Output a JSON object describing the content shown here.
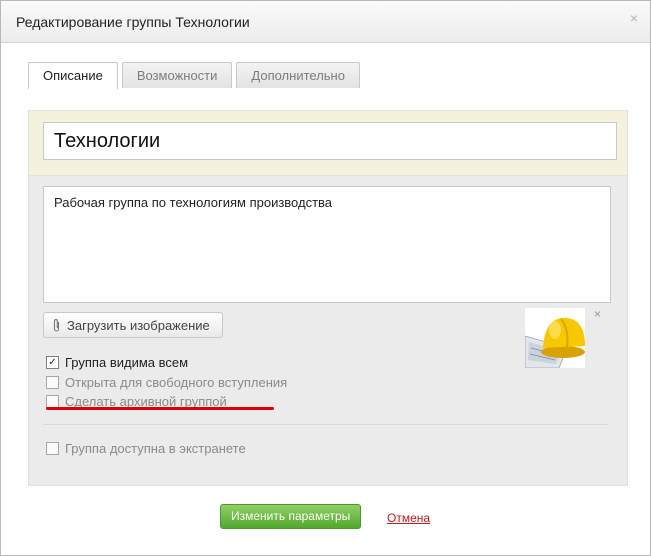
{
  "dialog": {
    "title": "Редактирование группы Технологии",
    "close_symbol": "×"
  },
  "tabs": [
    {
      "label": "Описание",
      "active": true
    },
    {
      "label": "Возможности",
      "active": false
    },
    {
      "label": "Дополнительно",
      "active": false
    }
  ],
  "form": {
    "group_name": "Технологии",
    "description": "Рабочая группа по технологиям производства",
    "upload_label": "Загрузить изображение",
    "image_remove_symbol": "×",
    "image_icon": "hard-hat-image",
    "checkboxes": [
      {
        "label": "Группа видима всем",
        "checked": true
      },
      {
        "label": "Открыта для свободного вступления",
        "checked": false
      },
      {
        "label": "Сделать архивной группой",
        "checked": false
      },
      {
        "label": "Группа доступна в экстранете",
        "checked": false
      }
    ],
    "checkmark": "✓"
  },
  "buttons": {
    "submit": "Изменить параметры",
    "cancel": "Отмена"
  },
  "colors": {
    "submit_green": "#6cbf43",
    "cancel_red": "#c91818",
    "highlight_underline": "#e00000",
    "name_area_bg": "#f4f2dc"
  }
}
